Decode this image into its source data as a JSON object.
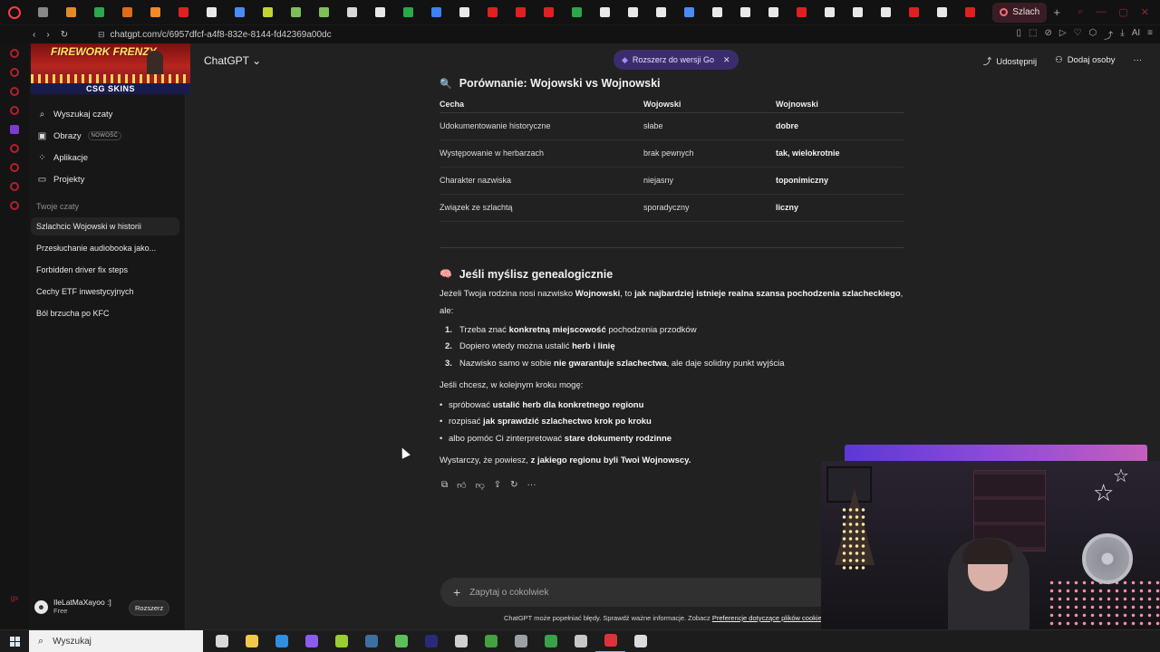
{
  "browser": {
    "active_tab": "Szlach",
    "url": "chatgpt.com/c/6957dfcf-a4f8-832e-8144-fd42369a00dc",
    "ai_label": "AI",
    "tab_icons": [
      {
        "name": "envelope-icon",
        "color": "#888888"
      },
      {
        "name": "colorful-cube-icon",
        "color": "#e08b2b"
      },
      {
        "name": "w-icon",
        "color": "#2aa84a"
      },
      {
        "name": "orange-square-icon",
        "color": "#e06b1a"
      },
      {
        "name": "orange-circle-icon",
        "color": "#f08a2a"
      },
      {
        "name": "youtube-icon",
        "color": "#e02020"
      },
      {
        "name": "flag-icon",
        "color": "#e8e8e8"
      },
      {
        "name": "chrome-icon",
        "color": "#4c8bf5"
      },
      {
        "name": "arrow-icon",
        "color": "#c4d23a"
      },
      {
        "name": "image-icon",
        "color": "#7fbf5a"
      },
      {
        "name": "image-icon",
        "color": "#7fbf5a"
      },
      {
        "name": "doc-icon",
        "color": "#d8d8d8"
      },
      {
        "name": "openai-icon",
        "color": "#e8e8e8"
      },
      {
        "name": "green-chat-icon",
        "color": "#2aa84a"
      },
      {
        "name": "blue-circle-icon",
        "color": "#3b82f6"
      },
      {
        "name": "openai-icon",
        "color": "#e8e8e8"
      },
      {
        "name": "youtube-icon",
        "color": "#e02020"
      },
      {
        "name": "youtube-icon",
        "color": "#e02020"
      },
      {
        "name": "youtube-icon",
        "color": "#e02020"
      },
      {
        "name": "green-image-icon",
        "color": "#2aa84a"
      },
      {
        "name": "tiktok-icon",
        "color": "#e8e8e8"
      },
      {
        "name": "x-icon",
        "color": "#e8e8e8"
      },
      {
        "name": "x-icon",
        "color": "#e8e8e8"
      },
      {
        "name": "google-icon",
        "color": "#4c8bf5"
      },
      {
        "name": "w-icon",
        "color": "#e8e8e8"
      },
      {
        "name": "x-icon",
        "color": "#e8e8e8"
      },
      {
        "name": "x-icon",
        "color": "#e8e8e8"
      },
      {
        "name": "youtube-icon",
        "color": "#e02020"
      },
      {
        "name": "x-icon",
        "color": "#e8e8e8"
      },
      {
        "name": "tiktok-icon",
        "color": "#e8e8e8"
      },
      {
        "name": "x-icon",
        "color": "#e8e8e8"
      },
      {
        "name": "youtube-icon",
        "color": "#e02020"
      },
      {
        "name": "x-icon",
        "color": "#e8e8e8"
      },
      {
        "name": "youtube-icon",
        "color": "#e02020"
      }
    ]
  },
  "sidebar": {
    "banner_title": "FIREWORK FRENZY",
    "banner_brand": "CSG SKINS",
    "nav": [
      {
        "label": "Wyszukaj czaty",
        "icon": "search-icon",
        "glyph": "⌕"
      },
      {
        "label": "Obrazy",
        "icon": "images-icon",
        "glyph": "▣",
        "badge": "NOWOŚĆ"
      },
      {
        "label": "Aplikacje",
        "icon": "apps-icon",
        "glyph": "⁘"
      },
      {
        "label": "Projekty",
        "icon": "folder-icon",
        "glyph": "▭"
      }
    ],
    "section_title": "Twoje czaty",
    "chats": [
      "Szlachcic Wojowski w historii",
      "Przesłuchanie audiobooka jako...",
      "Forbidden driver fix steps",
      "Cechy ETF inwestycyjnych",
      "Ból brzucha po KFC"
    ],
    "user": {
      "name": "IleLatMaXayoo :]",
      "plan": "Free",
      "upgrade": "Rozszerz"
    }
  },
  "header": {
    "model": "ChatGPT",
    "promo": "Rozszerz do wersji Go",
    "share": "Udostępnij",
    "add_people": "Dodaj osoby",
    "more": "···"
  },
  "comparison": {
    "heading": "Porównanie: Wojowski vs Wojnowski",
    "columns": [
      "Cecha",
      "Wojowski",
      "Wojnowski"
    ],
    "rows": [
      [
        "Udokumentowanie historyczne",
        "słabe",
        "dobre"
      ],
      [
        "Występowanie w herbarzach",
        "brak pewnych",
        "tak, wielokrotnie"
      ],
      [
        "Charakter nazwiska",
        "niejasny",
        "toponimiczny"
      ],
      [
        "Związek ze szlachtą",
        "sporadyczny",
        "liczny"
      ]
    ]
  },
  "genealogy": {
    "heading": "Jeśli myślisz genealogicznie",
    "intro": [
      {
        "t": "Jeżeli Twoja rodzina nosi nazwisko ",
        "b": false
      },
      {
        "t": "Wojnowski",
        "b": true
      },
      {
        "t": ", to ",
        "b": false
      },
      {
        "t": "jak najbardziej istnieje realna szansa pochodzenia szlacheckiego",
        "b": true
      },
      {
        "t": ", ale:",
        "b": false
      }
    ],
    "steps": [
      {
        "num": "1.",
        "parts": [
          {
            "t": "Trzeba znać ",
            "b": false
          },
          {
            "t": "konkretną miejscowość",
            "b": true
          },
          {
            "t": " pochodzenia przodków",
            "b": false
          }
        ]
      },
      {
        "num": "2.",
        "parts": [
          {
            "t": "Dopiero wtedy można ustalić ",
            "b": false
          },
          {
            "t": "herb i linię",
            "b": true
          }
        ]
      },
      {
        "num": "3.",
        "parts": [
          {
            "t": "Nazwisko samo w sobie ",
            "b": false
          },
          {
            "t": "nie gwarantuje szlachectwa",
            "b": true
          },
          {
            "t": ", ale daje solidny punkt wyjścia",
            "b": false
          }
        ]
      }
    ],
    "offer_intro": "Jeśli chcesz, w kolejnym kroku mogę:",
    "offers": [
      [
        {
          "t": "spróbować ",
          "b": false
        },
        {
          "t": "ustalić herb dla konkretnego regionu",
          "b": true
        }
      ],
      [
        {
          "t": "rozpisać ",
          "b": false
        },
        {
          "t": "jak sprawdzić szlachectwo krok po kroku",
          "b": true
        }
      ],
      [
        {
          "t": "albo pomóc Ci zinterpretować ",
          "b": false
        },
        {
          "t": "stare dokumenty rodzinne",
          "b": true
        }
      ]
    ],
    "closing": [
      {
        "t": "Wystarczy, że powiesz, ",
        "b": false
      },
      {
        "t": "z jakiego regionu byli Twoi Wojnowscy.",
        "b": true
      }
    ]
  },
  "composer": {
    "placeholder": "Zapytaj o cokolwiek"
  },
  "disclaimer": {
    "text": "ChatGPT może popełniać błędy. Sprawdź ważne informacje. Zobacz ",
    "link": "Preferencje dotyczące plików cookie"
  },
  "taskbar": {
    "search_placeholder": "Wyszukaj",
    "apps": [
      {
        "name": "task-view-icon",
        "color": "#d9d9d9"
      },
      {
        "name": "file-explorer-icon",
        "color": "#f2c84b"
      },
      {
        "name": "vscode-icon",
        "color": "#2f8fe0"
      },
      {
        "name": "obsidian-icon",
        "color": "#8a5cf0"
      },
      {
        "name": "game-icon",
        "color": "#9acd32"
      },
      {
        "name": "steam-icon",
        "color": "#3d6fa3"
      },
      {
        "name": "spreadsheet-icon",
        "color": "#5cbf5c"
      },
      {
        "name": "premiere-icon",
        "color": "#2a2a7a"
      },
      {
        "name": "settings-icon",
        "color": "#d0d0d0"
      },
      {
        "name": "minecraft-icon",
        "color": "#44a040"
      },
      {
        "name": "chrome-like-icon",
        "color": "#9aa0a6"
      },
      {
        "name": "book-icon",
        "color": "#3aa04a"
      },
      {
        "name": "shield-icon",
        "color": "#c7c7c7"
      },
      {
        "name": "opera-icon",
        "color": "#e0313b"
      },
      {
        "name": "obs-icon",
        "color": "#dcdcdc"
      }
    ]
  }
}
